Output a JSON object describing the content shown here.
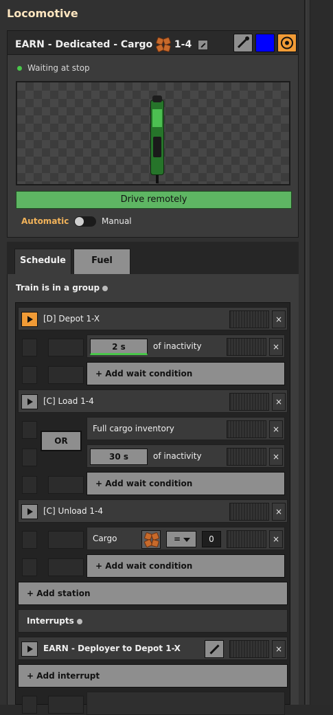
{
  "window": {
    "title": "Locomotive"
  },
  "train": {
    "name": "EARN - Dedicated - Cargo",
    "name_suffix": "1-4",
    "status": "Waiting at stop",
    "drive_label": "Drive remotely",
    "mode_auto": "Automatic",
    "mode_manual": "Manual",
    "color": "#0000ff",
    "accent": "#f19b36"
  },
  "tabs": {
    "schedule": "Schedule",
    "fuel": "Fuel"
  },
  "schedule": {
    "group_label": "Train is in a group",
    "stations": [
      {
        "name": "[D]  Depot 1-X",
        "icon": "depot-icon",
        "conditions": [
          {
            "value": "2 s",
            "label": "of inactivity"
          }
        ]
      },
      {
        "name": "[C]  Load 1-4",
        "icon": "cargo-icon",
        "connector": "OR",
        "conditions": [
          {
            "label": "Full cargo inventory"
          },
          {
            "value": "30 s",
            "label": "of inactivity"
          }
        ]
      },
      {
        "name": "[C]  Unload 1-4",
        "icon": "cargo-icon",
        "conditions": [
          {
            "label": "Cargo",
            "operator": "=",
            "amount": "0"
          }
        ]
      }
    ],
    "add_wait_label": "+ Add wait condition",
    "add_station_label": "+ Add station",
    "interrupts_label": "Interrupts",
    "interrupts": [
      {
        "name": "EARN - Deployer to Depot 1-X"
      }
    ],
    "add_interrupt_label": "+ Add interrupt",
    "close_glyph": "×"
  }
}
